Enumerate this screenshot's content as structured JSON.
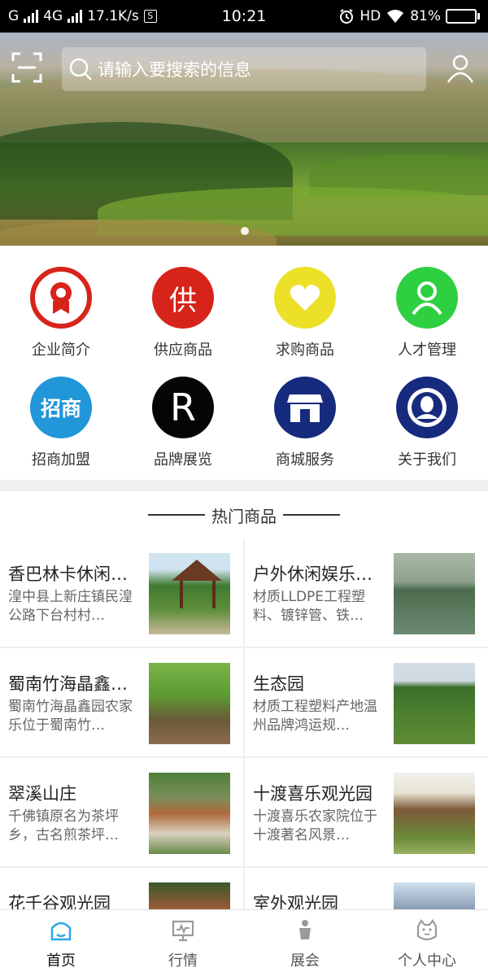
{
  "status_bar": {
    "carrier_left": "G",
    "network": "4G",
    "speed": "17.1K/s",
    "speed_badge": "S",
    "time": "10:21",
    "hd": "HD",
    "battery": "81%",
    "battery_level": 0.81
  },
  "header": {
    "search_placeholder": "请输入要搜索的信息",
    "icons": [
      "scan-icon",
      "search-icon",
      "user-icon"
    ]
  },
  "categories": [
    {
      "label": "企业简介",
      "icon": "award-badge-icon",
      "color": "#d7241b"
    },
    {
      "label": "供应商品",
      "icon": "supply-char-icon",
      "glyph": "供",
      "color": "#d7241b"
    },
    {
      "label": "求购商品",
      "icon": "heart-icon",
      "color": "#ece128"
    },
    {
      "label": "人才管理",
      "icon": "person-icon",
      "color": "#2fcf42"
    },
    {
      "label": "招商加盟",
      "icon": "investment-text-icon",
      "glyph": "招商",
      "color": "#2196d8"
    },
    {
      "label": "品牌展览",
      "icon": "registered-r-icon",
      "glyph": "R",
      "color": "#050505"
    },
    {
      "label": "商城服务",
      "icon": "storefront-icon",
      "color": "#162b7e"
    },
    {
      "label": "关于我们",
      "icon": "avatar-circle-icon",
      "color": "#162b7e"
    }
  ],
  "hot_section": {
    "title": "热门商品"
  },
  "products": [
    {
      "name": "香巴林卡休闲…",
      "desc": "湟中县上新庄镇民湟公路下台村村…"
    },
    {
      "name": "户外休闲娱乐…",
      "desc": "材质LLDPE工程塑料、镀锌管、铁…"
    },
    {
      "name": "蜀南竹海晶鑫…",
      "desc": "蜀南竹海晶鑫园农家乐位于蜀南竹…"
    },
    {
      "name": "生态园",
      "desc": "材质工程塑料产地温州品牌鸿运规…"
    },
    {
      "name": "翠溪山庄",
      "desc": "千佛镇原名为茶坪乡，古名煎茶坪…"
    },
    {
      "name": "十渡喜乐观光园",
      "desc": "十渡喜乐农家院位于十渡著名风景…"
    },
    {
      "name": "花千谷观光园",
      "desc": ""
    },
    {
      "name": "室外观光园",
      "desc": ""
    }
  ],
  "tabbar": [
    {
      "label": "首页",
      "icon": "home-icon",
      "active": true
    },
    {
      "label": "行情",
      "icon": "monitor-chart-icon",
      "active": false
    },
    {
      "label": "展会",
      "icon": "exhibition-icon",
      "active": false
    },
    {
      "label": "个人中心",
      "icon": "profile-icon",
      "active": false
    }
  ],
  "colors": {
    "accent_blue": "#2196d8",
    "tab_active_icon": "#2aa8e6",
    "tab_inactive_icon": "#9a9a9a"
  }
}
